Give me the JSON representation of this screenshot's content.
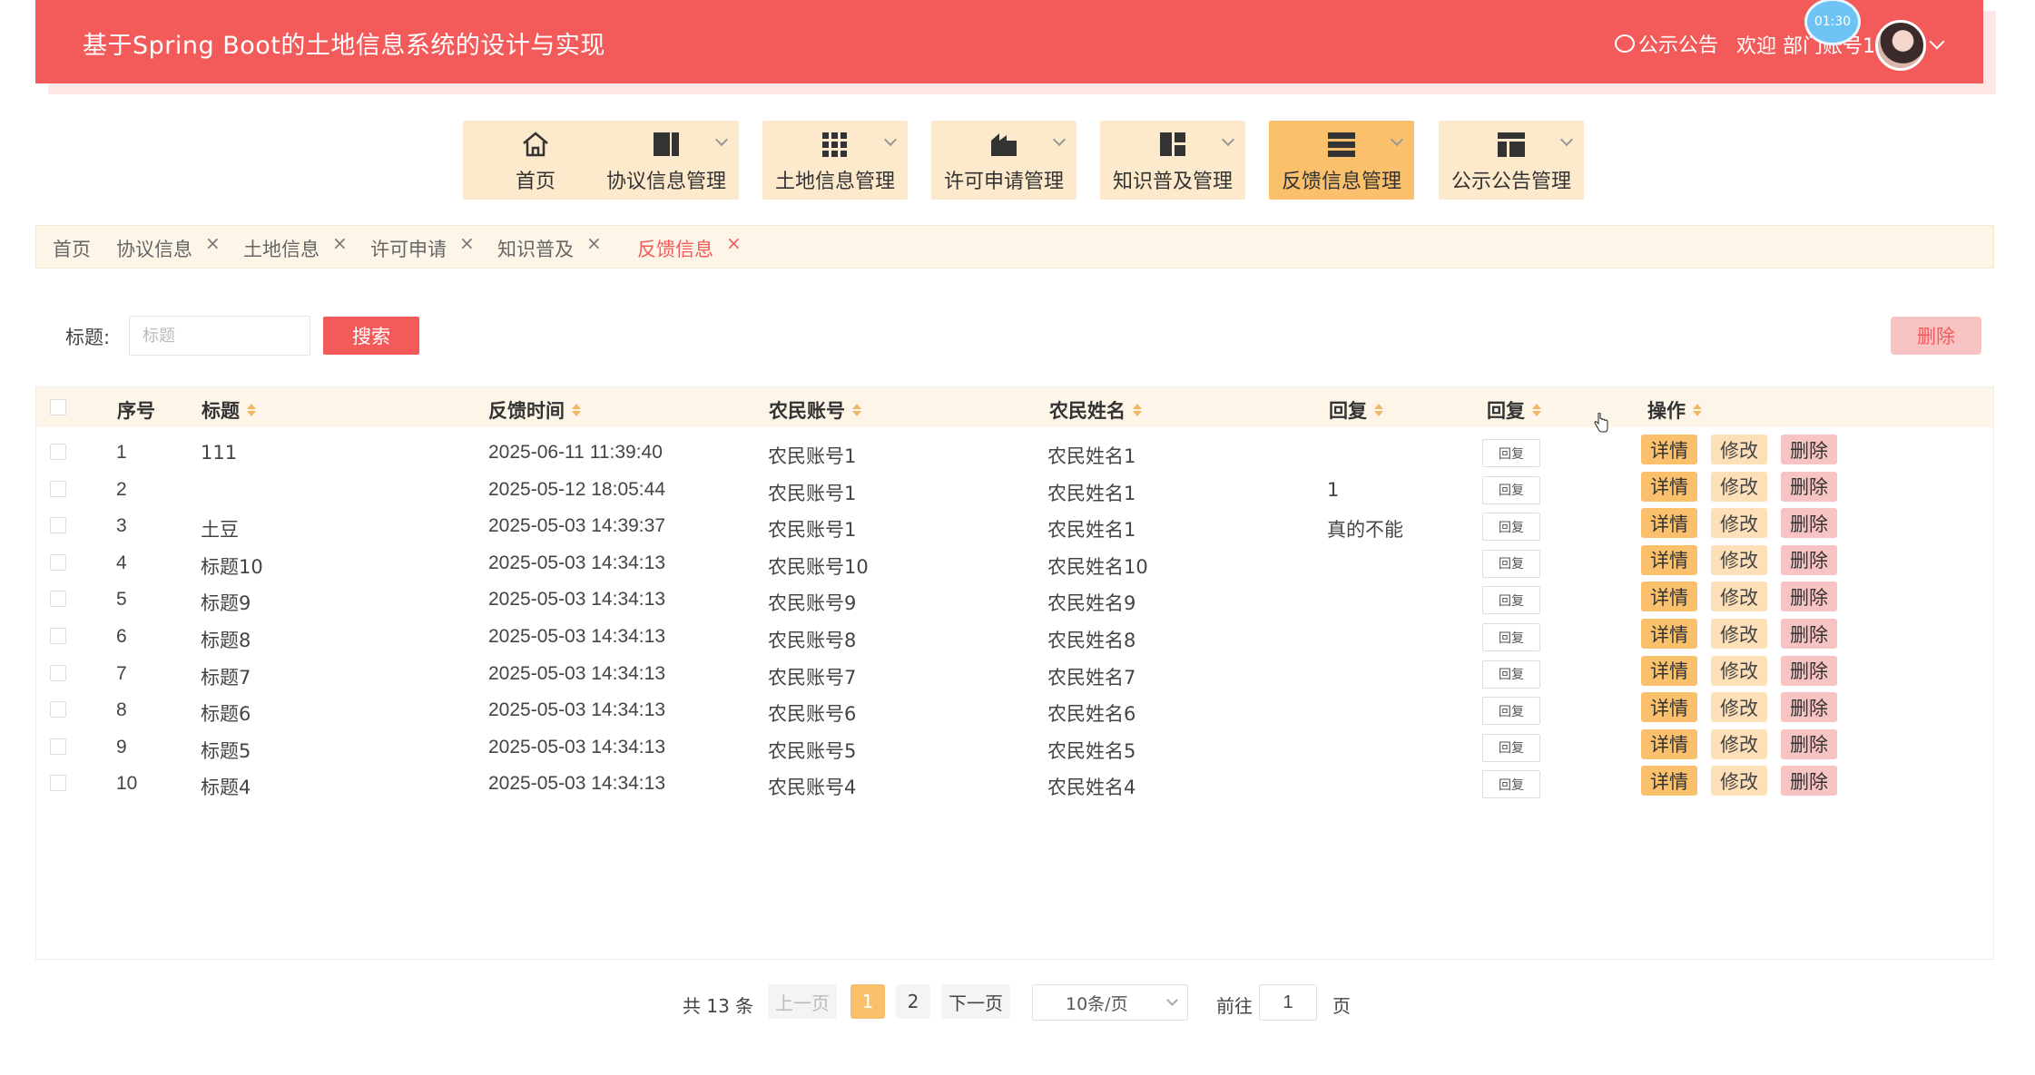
{
  "header": {
    "title": "基于Spring Boot的土地信息系统的设计与实现",
    "notice_label": "公示公告",
    "welcome_text": "欢迎 部门账号1",
    "timer": "01:30"
  },
  "nav": [
    {
      "label": "首页",
      "icon": "home-icon",
      "has_dropdown": false,
      "active": false
    },
    {
      "label": "协议信息管理",
      "icon": "columns-icon",
      "has_dropdown": true,
      "active": false
    },
    {
      "label": "土地信息管理",
      "icon": "grid-icon",
      "has_dropdown": true,
      "active": false
    },
    {
      "label": "许可申请管理",
      "icon": "factory-icon",
      "has_dropdown": true,
      "active": false
    },
    {
      "label": "知识普及管理",
      "icon": "layout-icon",
      "has_dropdown": true,
      "active": false
    },
    {
      "label": "反馈信息管理",
      "icon": "list-icon",
      "has_dropdown": true,
      "active": true
    },
    {
      "label": "公示公告管理",
      "icon": "panel-icon",
      "has_dropdown": true,
      "active": false
    }
  ],
  "tabs": [
    {
      "label": "首页",
      "closable": false,
      "active": false
    },
    {
      "label": "协议信息",
      "closable": true,
      "active": false
    },
    {
      "label": "土地信息",
      "closable": true,
      "active": false
    },
    {
      "label": "许可申请",
      "closable": true,
      "active": false
    },
    {
      "label": "知识普及",
      "closable": true,
      "active": false
    },
    {
      "label": "反馈信息",
      "closable": true,
      "active": true
    }
  ],
  "tab_close_glyph": "×",
  "search": {
    "label": "标题:",
    "placeholder": "标题",
    "value": "",
    "button": "搜索",
    "delete_button": "删除"
  },
  "table": {
    "headers": [
      "序号",
      "标题",
      "反馈时间",
      "农民账号",
      "农民姓名",
      "回复",
      "回复",
      "操作"
    ],
    "reply_button": "回复",
    "actions": {
      "detail": "详情",
      "edit": "修改",
      "delete": "删除"
    },
    "rows": [
      {
        "no": "1",
        "title": "111",
        "time": "2025-06-11 11:39:40",
        "account": "农民账号1",
        "name": "农民姓名1",
        "reply": ""
      },
      {
        "no": "2",
        "title": "",
        "time": "2025-05-12 18:05:44",
        "account": "农民账号1",
        "name": "农民姓名1",
        "reply": "1"
      },
      {
        "no": "3",
        "title": "土豆",
        "time": "2025-05-03 14:39:37",
        "account": "农民账号1",
        "name": "农民姓名1",
        "reply": "真的不能"
      },
      {
        "no": "4",
        "title": "标题10",
        "time": "2025-05-03 14:34:13",
        "account": "农民账号10",
        "name": "农民姓名10",
        "reply": ""
      },
      {
        "no": "5",
        "title": "标题9",
        "time": "2025-05-03 14:34:13",
        "account": "农民账号9",
        "name": "农民姓名9",
        "reply": ""
      },
      {
        "no": "6",
        "title": "标题8",
        "time": "2025-05-03 14:34:13",
        "account": "农民账号8",
        "name": "农民姓名8",
        "reply": ""
      },
      {
        "no": "7",
        "title": "标题7",
        "time": "2025-05-03 14:34:13",
        "account": "农民账号7",
        "name": "农民姓名7",
        "reply": ""
      },
      {
        "no": "8",
        "title": "标题6",
        "time": "2025-05-03 14:34:13",
        "account": "农民账号6",
        "name": "农民姓名6",
        "reply": ""
      },
      {
        "no": "9",
        "title": "标题5",
        "time": "2025-05-03 14:34:13",
        "account": "农民账号5",
        "name": "农民姓名5",
        "reply": ""
      },
      {
        "no": "10",
        "title": "标题4",
        "time": "2025-05-03 14:34:13",
        "account": "农民账号4",
        "name": "农民姓名4",
        "reply": ""
      }
    ]
  },
  "pagination": {
    "total": "共 13 条",
    "prev": "上一页",
    "pages": [
      "1",
      "2"
    ],
    "current_page": "1",
    "next": "下一页",
    "page_size": "10条/页",
    "goto_label": "前往",
    "goto_value": "1",
    "page_suffix": "页"
  },
  "colors": {
    "primary": "#f35b5b",
    "accent": "#fbc06c",
    "light_accent": "#fde9cc"
  }
}
